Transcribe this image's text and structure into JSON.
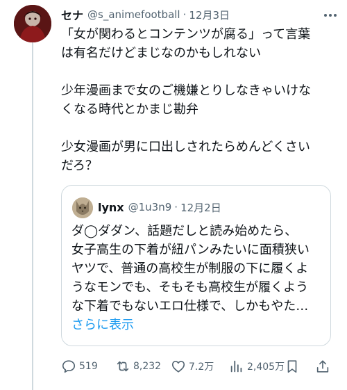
{
  "post": {
    "author_name": "セナ",
    "handle": "@s_animefootball",
    "separator": "·",
    "date": "12月3日",
    "body_lines": [
      "「女が関わるとコンテンツが腐る」って言葉",
      "は有名だけどまじなのかもしれない",
      "",
      "少年漫画まで女のご機嫌とりしなきゃいけな",
      "くなる時代とかまじ勘弁",
      "",
      "少女漫画が男に口出しされたらめんどくさい",
      "だろ？"
    ]
  },
  "quoted_post": {
    "author_name": "lynx",
    "handle": "@1u3n9",
    "separator": "·",
    "date": "12月2日",
    "body_lines": [
      "ダ◯ダダン、話題だしと読み始めたら、",
      "女子高生の下着が紐パンみたいに面積狭い",
      "ヤツで、普通の高校生が制服の下に履くよ",
      "うなモンでも、そもそも高校生が履くよう",
      "な下着でもないエロ仕様で、しかもやた…"
    ],
    "show_more": "さらに表示"
  },
  "actions": {
    "replies": "519",
    "reposts": "8,232",
    "likes": "7.2万",
    "views": "2,405万"
  },
  "icons": {
    "more": "more-horizontal-icon",
    "reply": "reply-icon",
    "repost": "repost-icon",
    "like": "heart-icon",
    "views": "analytics-icon",
    "bookmark": "bookmark-icon",
    "share": "share-icon"
  },
  "colors": {
    "text": "#0f1419",
    "secondary": "#536471",
    "link": "#1d9bf0",
    "border": "#cfd9de"
  }
}
